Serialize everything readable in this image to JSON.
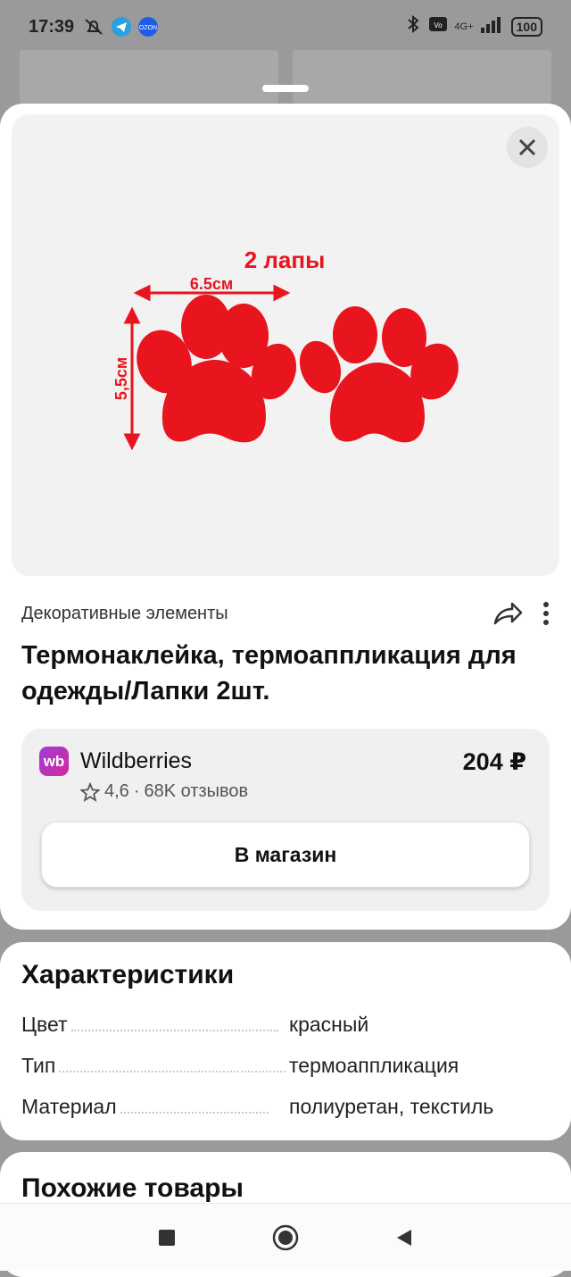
{
  "status_bar": {
    "time": "17:39",
    "battery": "100",
    "network": "4G+",
    "icons": [
      "alarm-off-icon",
      "telegram-icon",
      "ozon-icon",
      "bluetooth-icon",
      "volte-icon",
      "signal-icon",
      "battery-icon"
    ]
  },
  "product_image": {
    "heading_text": "2 лапы",
    "width_label": "6.5см",
    "height_label": "5,5см",
    "paw_color": "#e8141e"
  },
  "category": "Декоративные элементы",
  "title": "Термонаклейка, термоаппликация для одежды/Лапки 2шт.",
  "shop": {
    "logo_text": "wb",
    "name": "Wildberries",
    "price": "204 ₽",
    "rating": "4,6",
    "reviews": "68K отзывов",
    "button_label": "В магазин"
  },
  "characteristics": {
    "heading": "Характеристики",
    "rows": [
      {
        "key": "Цвет",
        "value": "красный"
      },
      {
        "key": "Тип",
        "value": "термоаппликация"
      },
      {
        "key": "Материал",
        "value": "полиуретан, текстиль"
      }
    ]
  },
  "similar": {
    "heading": "Похожие товары"
  },
  "colors": {
    "accent_brand": "#c12fb8",
    "background_dim": "#9a9a9a"
  }
}
